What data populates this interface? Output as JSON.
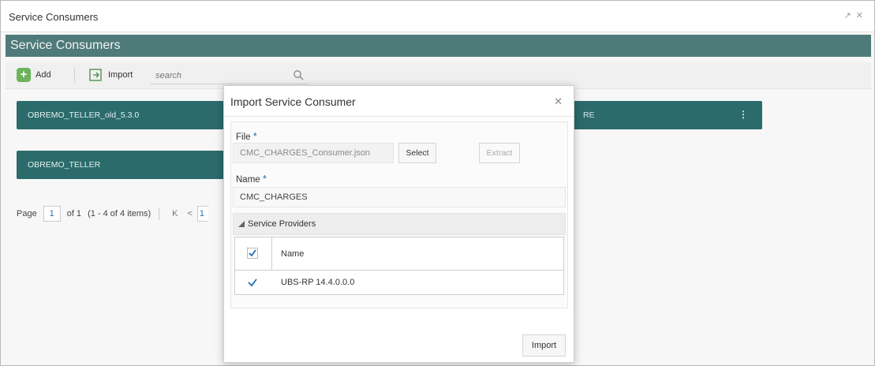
{
  "window": {
    "title": "Service Consumers"
  },
  "header": {
    "title": "Service Consumers"
  },
  "toolbar": {
    "add_label": "Add",
    "import_label": "Import",
    "search_placeholder": "search"
  },
  "cards": [
    {
      "name": "OBREMO_TELLER_old_5.3.0",
      "partial_text": "RE"
    },
    {
      "name": "OBREMO_TELLER"
    }
  ],
  "pager": {
    "page_label": "Page",
    "page": "1",
    "of_text": "of 1",
    "items_text": "(1 - 4 of 4 items)",
    "first": "K",
    "prev": "<",
    "box": "1"
  },
  "dialog": {
    "title": "Import Service Consumer",
    "file_label": "File",
    "required_mark": "*",
    "file_value": "CMC_CHARGES_Consumer.json",
    "select_label": "Select",
    "extract_label": "Extract",
    "name_label": "Name",
    "name_value": "CMC_CHARGES",
    "providers_section": "Service Providers",
    "grid_header": "Name",
    "rows": [
      {
        "name": "UBS-RP 14.4.0.0.0",
        "checked": true
      }
    ],
    "import_label": "Import"
  },
  "colors": {
    "header": "#4f7a7a",
    "card": "#2b6b6b",
    "add": "#6bb45b",
    "accent": "#1f6fb6"
  }
}
